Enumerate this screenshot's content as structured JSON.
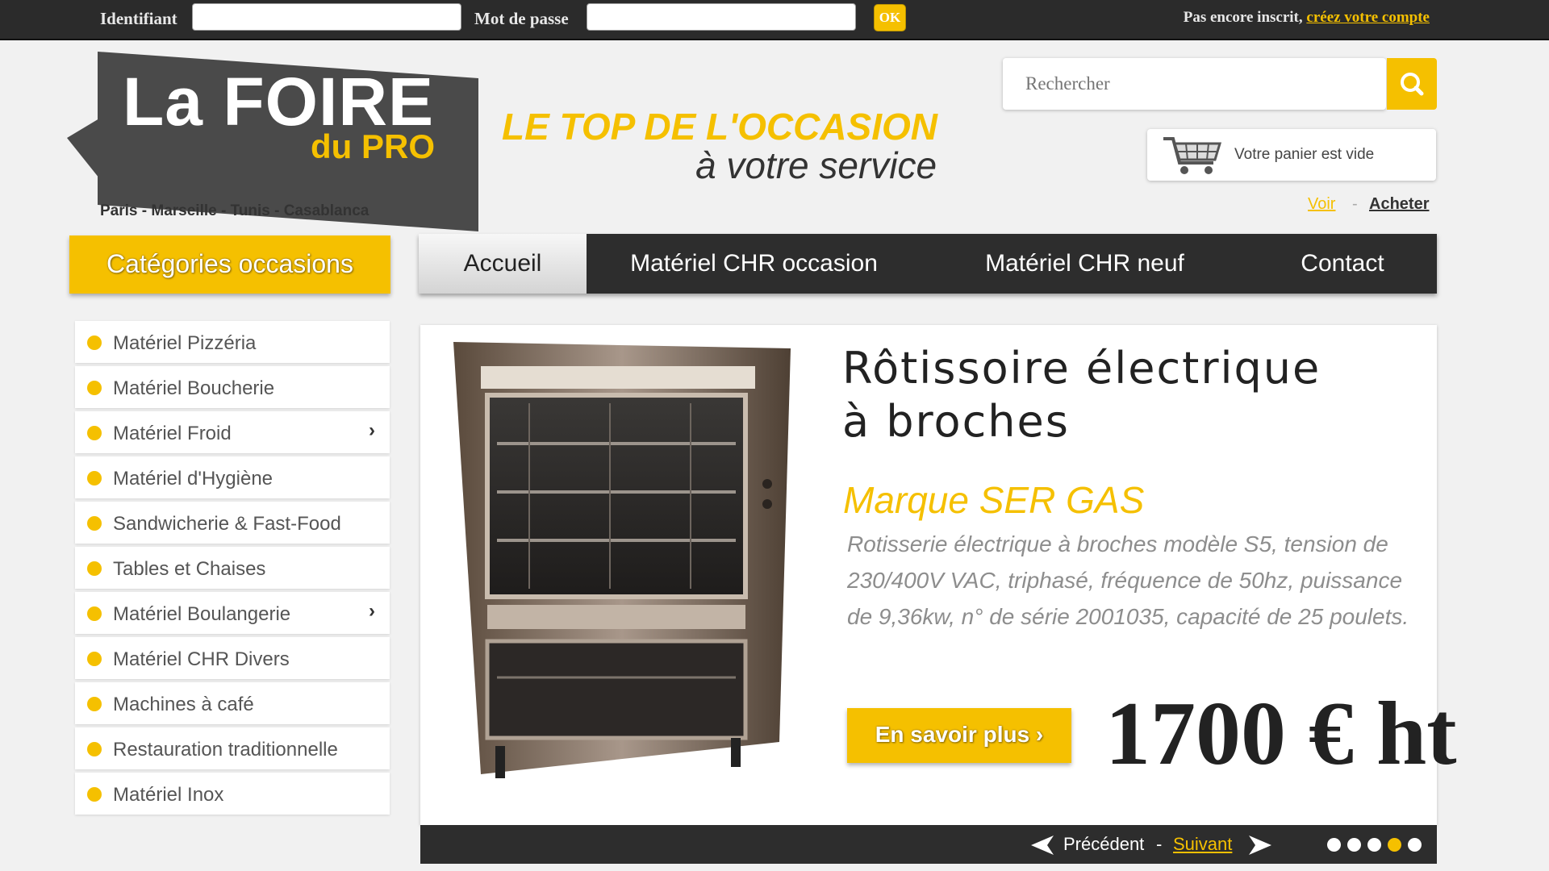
{
  "topbar": {
    "login_label": "Identifiant",
    "login_value": "",
    "password_label": "Mot de passe",
    "password_value": "",
    "ok_label": "OK",
    "register_text": "Pas encore inscrit,",
    "register_link": "créez votre compte"
  },
  "header": {
    "logo_line1": "La FOIRE",
    "logo_line2": "du PRO",
    "cities": "Paris - Marseille - Tunis - Casablanca",
    "slogan_line1": "LE TOP DE L'OCCASION",
    "slogan_line2": "à votre service",
    "search_placeholder": "Rechercher",
    "cart_label": "Votre panier est vide",
    "link_voir": "Voir",
    "link_separator": "-",
    "link_acheter": "Acheter"
  },
  "nav": {
    "categories_label": "Catégories occasions",
    "items": [
      {
        "label": "Accueil",
        "active": true
      },
      {
        "label": "Matériel CHR occasion",
        "active": false
      },
      {
        "label": "Matériel CHR neuf",
        "active": false
      },
      {
        "label": "Contact",
        "active": false
      }
    ]
  },
  "sidebar": {
    "items": [
      {
        "label": "Matériel Pizzéria",
        "arrow": ""
      },
      {
        "label": "Matériel Boucherie",
        "arrow": ""
      },
      {
        "label": "Matériel Froid",
        "arrow": "›"
      },
      {
        "label": "Matériel d'Hygiène",
        "arrow": ""
      },
      {
        "label": "Sandwicherie & Fast-Food",
        "arrow": ""
      },
      {
        "label": "Tables et Chaises",
        "arrow": ""
      },
      {
        "label": "Matériel Boulangerie",
        "arrow": "›"
      },
      {
        "label": "Matériel CHR Divers",
        "arrow": ""
      },
      {
        "label": "Machines à café",
        "arrow": ""
      },
      {
        "label": "Restauration traditionnelle",
        "arrow": ""
      },
      {
        "label": "Matériel Inox",
        "arrow": ""
      }
    ]
  },
  "feature": {
    "title_line1": "Rôtissoire électrique",
    "title_line2": "à broches",
    "brand": "Marque SER GAS",
    "description": "Rotisserie électrique à broches modèle S5, tension de 230/400V VAC, triphasé, fréquence de 50hz, puissance de 9,36kw, n° de série 2001035, capacité de 25 poulets.",
    "more_button": "En savoir plus ›",
    "price": "1700 € ht"
  },
  "slider": {
    "prev_label": "Précédent",
    "separator": "-",
    "next_label": "Suivant",
    "slide_count": 5,
    "active_slide": 4
  },
  "colors": {
    "accent": "#f5c000",
    "dark": "#2d2d2d"
  }
}
